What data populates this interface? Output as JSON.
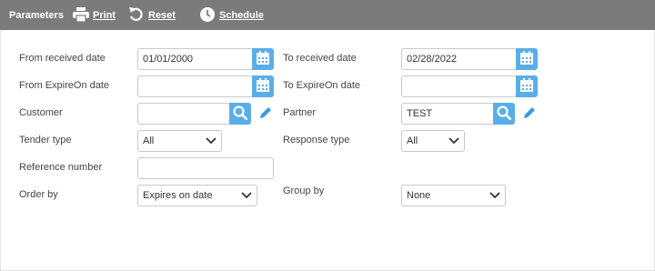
{
  "toolbar": {
    "title": "Parameters",
    "print_label": "Print",
    "reset_label": "Reset",
    "schedule_label": "Schedule"
  },
  "form": {
    "from_received_date": {
      "label": "From received date",
      "value": "01/01/2000"
    },
    "to_received_date": {
      "label": "To received date",
      "value": "02/28/2022"
    },
    "from_expireon_date": {
      "label": "From ExpireOn date",
      "value": ""
    },
    "to_expireon_date": {
      "label": "To ExpireOn date",
      "value": ""
    },
    "customer": {
      "label": "Customer",
      "value": ""
    },
    "partner": {
      "label": "Partner",
      "value": "TEST"
    },
    "tender_type": {
      "label": "Tender type",
      "value": "All"
    },
    "response_type": {
      "label": "Response type",
      "value": "All"
    },
    "reference_number": {
      "label": "Reference number",
      "value": ""
    },
    "order_by": {
      "label": "Order by",
      "value": "Expires on date"
    },
    "group_by": {
      "label": "Group by",
      "value": "None"
    }
  },
  "colors": {
    "topbar": "#7b7b7b",
    "icon_button": "#5aaee8",
    "pencil": "#3a9be0"
  },
  "icons": {
    "print": "printer-icon",
    "reset": "undo-icon",
    "schedule": "clock-icon",
    "calendar": "calendar-icon",
    "search": "search-icon",
    "edit": "pencil-icon",
    "dropdown": "chevron-down-icon"
  }
}
